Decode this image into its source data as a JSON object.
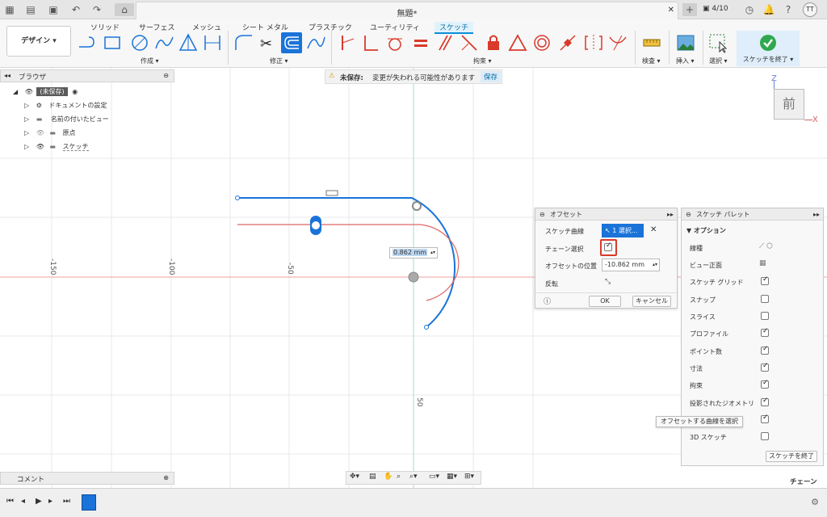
{
  "titlebar": {
    "doc_title": "無題*",
    "job_count": "4/10",
    "user_initials": "TT"
  },
  "toolbar": {
    "design_label": "デザイン ▾",
    "tabs": [
      "ソリッド",
      "サーフェス",
      "メッシュ",
      "シート メタル",
      "プラスチック",
      "ユーティリティ",
      "スケッチ"
    ],
    "groups": {
      "create": "作成 ▾",
      "modify": "修正 ▾",
      "constraints": "拘束 ▾",
      "inspect": "検査 ▾",
      "insert": "挿入 ▾",
      "select": "選択 ▾",
      "finish": "スケッチを終了 ▾"
    }
  },
  "browser": {
    "title": "ブラウザ",
    "items": [
      "(未保存)",
      "ドキュメントの設定",
      "名前の付いたビュー",
      "原点",
      "スケッチ"
    ]
  },
  "unsaved": {
    "label": "未保存:",
    "message": "変更が失われる可能性があります",
    "save": "保存"
  },
  "viewcube": {
    "face": "前",
    "axis_z": "Z",
    "axis_x": "X"
  },
  "axis_numbers": [
    "-150",
    "-100",
    "-50",
    "50"
  ],
  "dimension": {
    "value": "0.862 mm"
  },
  "offset_dialog": {
    "title": "オフセット",
    "curve_label": "スケッチ曲線",
    "curve_value": "1 選択...",
    "chain_label": "チェーン選択",
    "chain_checked": true,
    "position_label": "オフセットの位置",
    "position_value": "-10.862 mm",
    "flip_label": "反転",
    "ok": "OK",
    "cancel": "キャンセル"
  },
  "palette": {
    "title": "スケッチ パレット",
    "section": "オプション",
    "rows": [
      {
        "label": "線種",
        "checked": null
      },
      {
        "label": "ビュー正面",
        "checked": null
      },
      {
        "label": "スケッチ グリッド",
        "checked": true
      },
      {
        "label": "スナップ",
        "checked": false
      },
      {
        "label": "スライス",
        "checked": false
      },
      {
        "label": "プロファイル",
        "checked": true
      },
      {
        "label": "ポイント数",
        "checked": true
      },
      {
        "label": "寸法",
        "checked": true
      },
      {
        "label": "拘束",
        "checked": true
      },
      {
        "label": "投影されたジオメトリ",
        "checked": true
      },
      {
        "label": "",
        "checked": true
      },
      {
        "label": "3D スケッチ",
        "checked": false
      }
    ],
    "finish": "スケッチを終了"
  },
  "tooltip": "オフセットする曲線を選択",
  "comment": {
    "label": "コメント"
  },
  "status": {
    "chain": "チェーン"
  },
  "colors": {
    "accent": "#0a8fd8",
    "curve_blue": "#1a73d9",
    "curve_red": "#e06666",
    "checkbox_highlight": "#d93a2b"
  }
}
